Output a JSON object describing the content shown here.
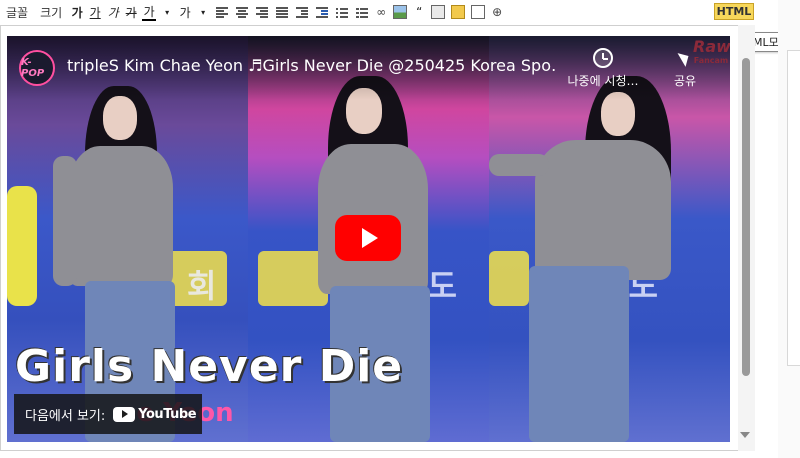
{
  "toolbar": {
    "font_label": "글꼴",
    "size_label": "크기",
    "bold": "가",
    "underline": "가",
    "italic": "가",
    "strike": "가",
    "font_color": "가",
    "bg_color": "가",
    "html_button": "HTML",
    "html_tooltip": "HTML모드"
  },
  "video": {
    "channel_logo": "K-POP",
    "title": "tripleS Kim Chae Yeon ♬Girls Never Die @250425 Korea Spo…",
    "watch_later": "나중에 시청…",
    "share": "공유",
    "watermark_main": "Raw",
    "watermark_sub": "Fancam",
    "banner_text_1": "남도",
    "banner_text_2": "남도",
    "banner_text_3": "회",
    "overlay_title": "Girls Never Die",
    "overlay_subtitle": "ae Yeon",
    "watch_on_label": "다음에서 보기:",
    "youtube_label": "YouTube"
  }
}
